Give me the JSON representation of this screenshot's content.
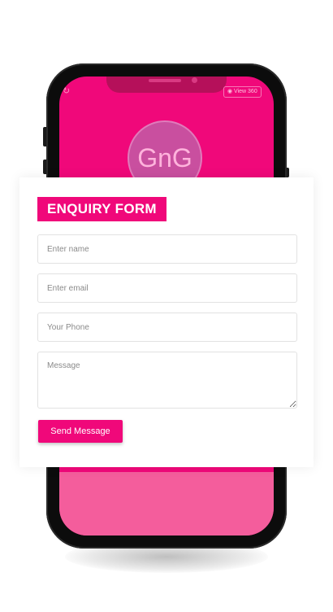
{
  "phone_screen": {
    "logo_text": "GnG",
    "view_badge_label": "◉ View 360",
    "refresh_icon": "refresh-icon"
  },
  "form": {
    "title": "ENQUIRY FORM",
    "name_placeholder": "Enter name",
    "email_placeholder": "Enter email",
    "phone_placeholder": "Your Phone",
    "message_placeholder": "Message",
    "submit_label": "Send Message"
  },
  "colors": {
    "accent": "#f0087a",
    "screen_bottom": "#f45d9c",
    "phone_frame": "#0c0c0c"
  }
}
